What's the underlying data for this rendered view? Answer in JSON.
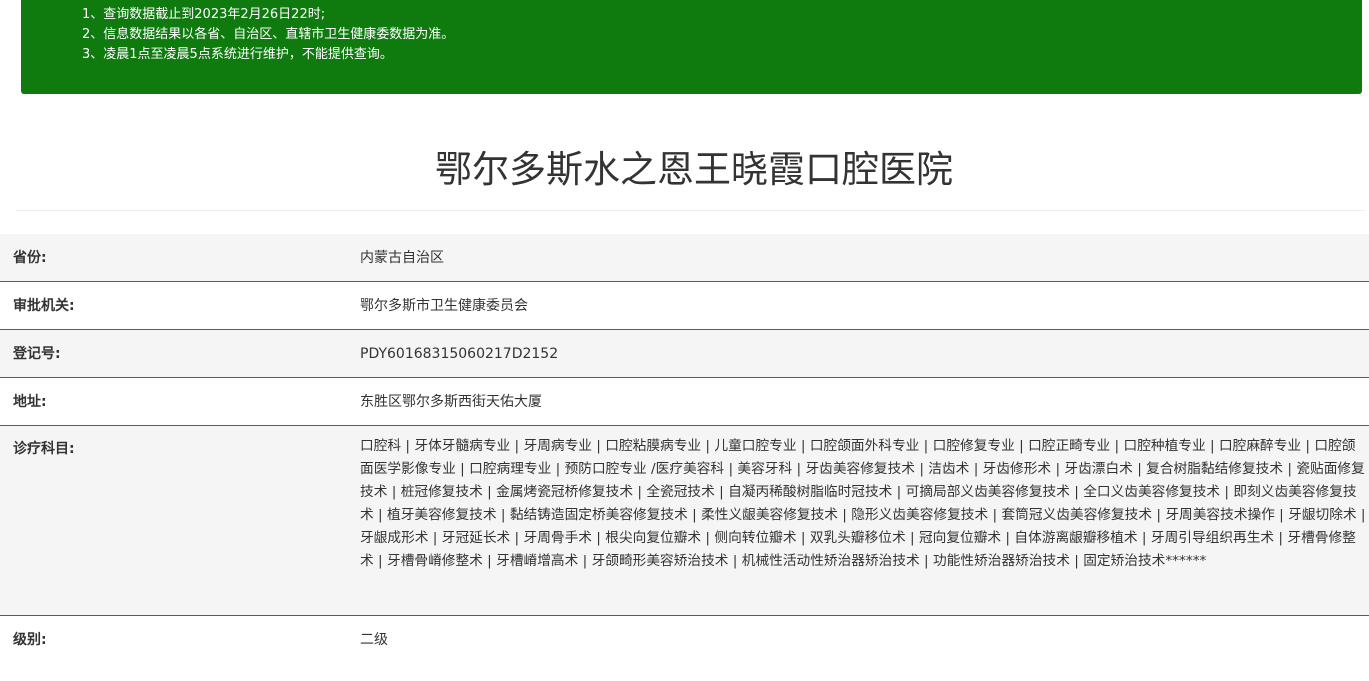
{
  "notice": {
    "lines": [
      "1、查询数据截止到2023年2月26日22时;",
      "2、信息数据结果以各省、自治区、直辖市卫生健康委数据为准。",
      "3、凌晨1点至凌晨5点系统进行维护，不能提供查询。"
    ]
  },
  "hospital": {
    "name": "鄂尔多斯水之恩王晓霞口腔医院"
  },
  "fields": {
    "province": {
      "label": "省份:",
      "value": "内蒙古自治区"
    },
    "authority": {
      "label": "审批机关:",
      "value": "鄂尔多斯市卫生健康委员会"
    },
    "registration": {
      "label": "登记号:",
      "value": "PDY60168315060217D2152"
    },
    "address": {
      "label": "地址:",
      "value": "东胜区鄂尔多斯西街天佑大厦"
    },
    "departments": {
      "label": "诊疗科目:",
      "value": "口腔科 | 牙体牙髓病专业 | 牙周病专业 | 口腔粘膜病专业 | 儿童口腔专业 | 口腔颌面外科专业 | 口腔修复专业 | 口腔正畸专业 | 口腔种植专业 | 口腔麻醉专业 | 口腔颌面医学影像专业 | 口腔病理专业 | 预防口腔专业 /医疗美容科 | 美容牙科 | 牙齿美容修复技术 | 洁齿术 | 牙齿修形术 | 牙齿漂白术 | 复合树脂黏结修复技术 | 瓷贴面修复技术 | 桩冠修复技术 | 金属烤瓷冠桥修复技术 | 全瓷冠技术 | 自凝丙稀酸树脂临时冠技术 | 可摘局部义齿美容修复技术 | 全口义齿美容修复技术 | 即刻义齿美容修复技术 | 植牙美容修复技术 | 黏结铸造固定桥美容修复技术 | 柔性义龈美容修复技术 | 隐形义齿美容修复技术 | 套筒冠义齿美容修复技术 | 牙周美容技术操作 | 牙龈切除术 | 牙龈成形术 | 牙冠延长术 | 牙周骨手术 | 根尖向复位瓣术 | 侧向转位瓣术 | 双乳头瓣移位术 | 冠向复位瓣术 | 自体游离龈瓣移植术 | 牙周引导组织再生术 | 牙槽骨修整术 | 牙槽骨嵴修整术 | 牙槽嵴增高术 | 牙颌畸形美容矫治技术 | 机械性活动性矫治器矫治技术 | 功能性矫治器矫治技术 | 固定矫治技术******"
    },
    "level": {
      "label": "级别:",
      "value": "二级"
    }
  }
}
